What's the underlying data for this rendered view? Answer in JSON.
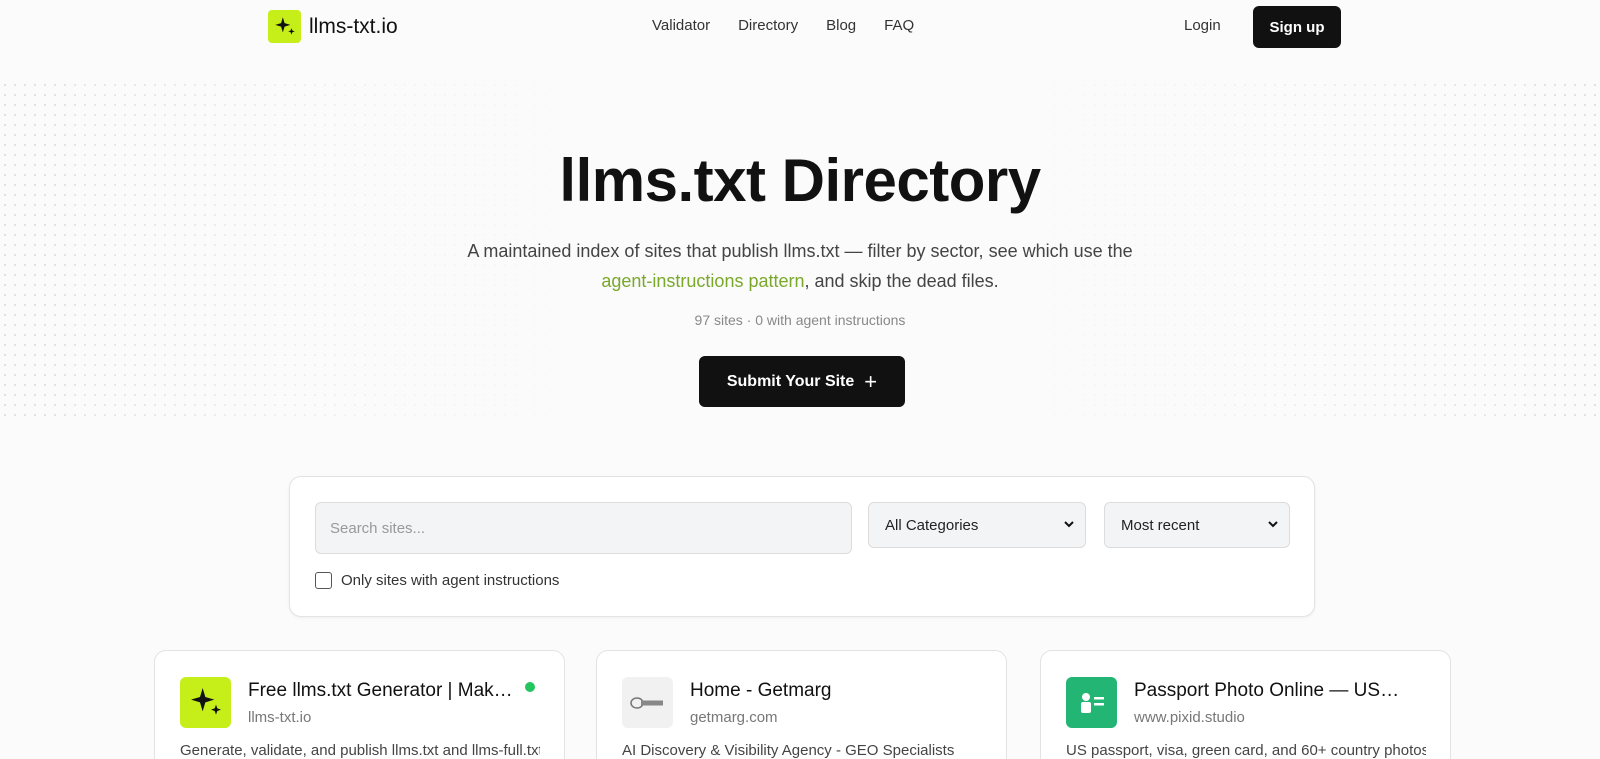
{
  "brand": {
    "name": "llms-txt.io",
    "accent": "#c6ef1a"
  },
  "nav": {
    "items": [
      {
        "label": "Validator"
      },
      {
        "label": "Directory"
      },
      {
        "label": "Blog"
      },
      {
        "label": "FAQ"
      }
    ],
    "login_label": "Login",
    "signup_label": "Sign up"
  },
  "hero": {
    "title": "llms.txt Directory",
    "desc_part1": "A maintained index of sites that publish llms.txt — filter by sector, see which use the ",
    "desc_link": "agent-instructions pattern",
    "desc_part2": ", and skip the dead files.",
    "stats": "97 sites · 0 with agent instructions",
    "submit_label": "Submit Your Site"
  },
  "filters": {
    "search_placeholder": "Search sites...",
    "category_selected": "All Categories",
    "sort_selected": "Most recent",
    "agent_only_label": "Only sites with agent instructions",
    "agent_only_checked": false
  },
  "cards": [
    {
      "title": "Free llms.txt Generator | Make llms.txt for your site",
      "domain": "llms-txt.io",
      "description": "Generate, validate, and publish llms.txt and llms-full.txt",
      "icon": "sparkles-icon",
      "icon_bg": "#c6ef1a",
      "status": "active",
      "status_color": "#22c55e"
    },
    {
      "title": "Home - Getmarg",
      "domain": "getmarg.com",
      "description": "AI Discovery & Visibility Agency - GEO Specialists",
      "icon": "getmarg-logo-icon",
      "icon_bg": "#f1f1f1"
    },
    {
      "title": "Passport Photo Online — US, UK, EU photos",
      "domain": "www.pixid.studio",
      "description": "US passport, visa, green card, and 60+ country photos",
      "icon": "id-card-icon",
      "icon_bg": "#22b573"
    }
  ]
}
